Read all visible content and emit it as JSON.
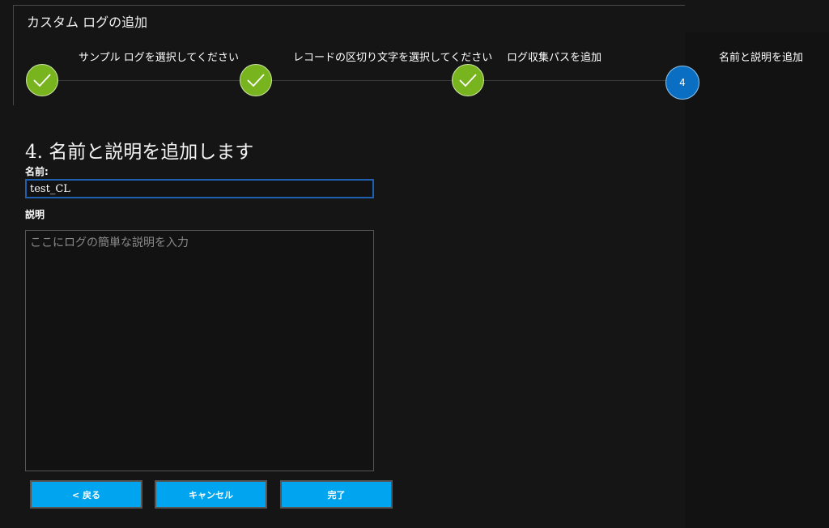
{
  "window": {
    "title": "カスタム ログの追加"
  },
  "wizard": {
    "steps": [
      {
        "label": "サンプル ログを選択してください",
        "status": "complete"
      },
      {
        "label": "レコードの区切り文字を選択してください",
        "status": "complete"
      },
      {
        "label": "ログ収集パスを追加",
        "status": "complete"
      },
      {
        "label": "名前と説明を追加",
        "status": "current",
        "number": "4"
      }
    ]
  },
  "form": {
    "heading": "4. 名前と説明を追加します",
    "name_label": "名前:",
    "name_value": "test_CL",
    "description_label": "説明",
    "description_placeholder": "ここにログの簡単な説明を入力",
    "description_value": ""
  },
  "buttons": {
    "back": "< 戻る",
    "cancel": "キャンセル",
    "finish": "完了"
  },
  "colors": {
    "step_complete": "#78b41e",
    "step_current": "#0a6fc2",
    "button": "#00a4ef",
    "background": "#121212"
  }
}
